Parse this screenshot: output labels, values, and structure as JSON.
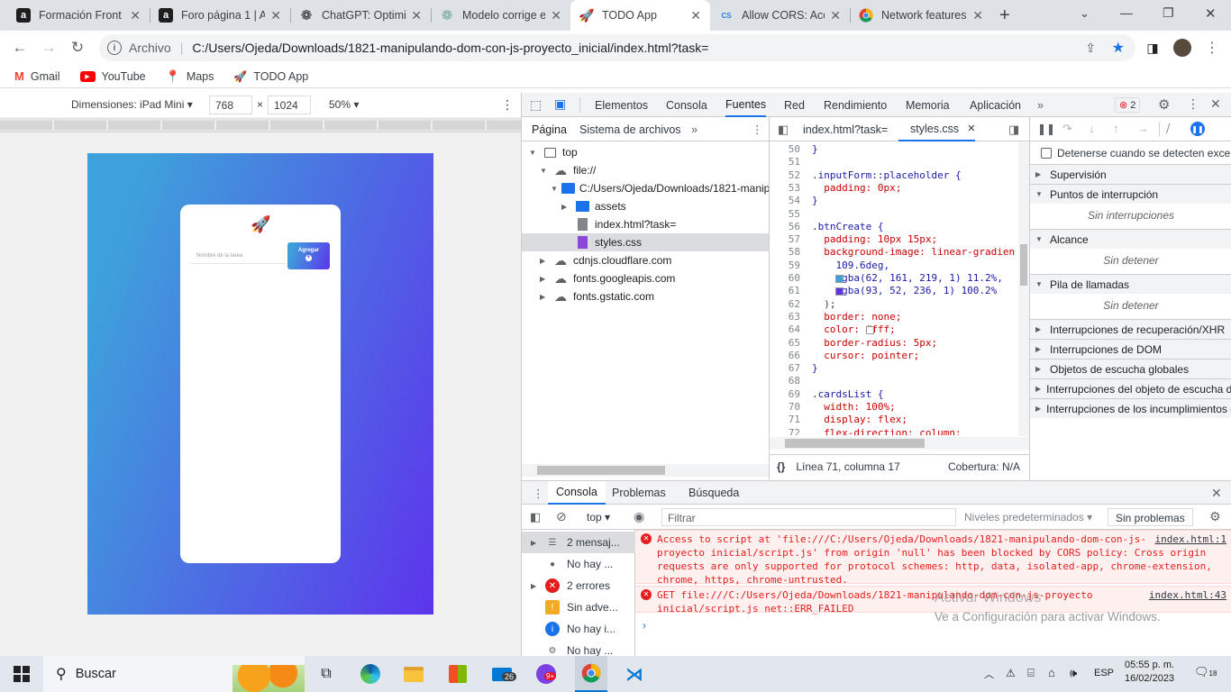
{
  "tabs": [
    {
      "title": "Formación Front",
      "favicon": "alura-icon",
      "active": false
    },
    {
      "title": "Foro página 1 | A",
      "favicon": "alura-icon",
      "active": false
    },
    {
      "title": "ChatGPT: Optimiz",
      "favicon": "openai-icon",
      "active": false
    },
    {
      "title": "Modelo corrige e",
      "favicon": "openai-icon",
      "active": false
    },
    {
      "title": "TODO App",
      "favicon": "rocket-icon",
      "active": true
    },
    {
      "title": "Allow CORS: Acc",
      "favicon": "cors-icon",
      "active": false
    },
    {
      "title": "Network features",
      "favicon": "chrome-icon",
      "active": false
    }
  ],
  "address": {
    "scheme_label": "Archivo",
    "url": "C:/Users/Ojeda/Downloads/1821-manipulando-dom-con-js-proyecto_inicial/index.html?task="
  },
  "bookmarks": [
    "Gmail",
    "YouTube",
    "Maps",
    "TODO App"
  ],
  "device_toolbar": {
    "dimensions_label": "Dimensiones: iPad Mini",
    "width": "768",
    "x": "×",
    "height": "1024",
    "zoom": "50%"
  },
  "todo_page": {
    "input_placeholder": "Nombre de la tarea",
    "add_button": "Agregar",
    "gradient_start": "#3ea1db",
    "gradient_end": "#5d34ec"
  },
  "devtools": {
    "panels": [
      "Elementos",
      "Consola",
      "Fuentes",
      "Red",
      "Rendimiento",
      "Memoria",
      "Aplicación"
    ],
    "active_panel": "Fuentes",
    "error_badge": "2",
    "navigator_tabs": [
      "Página",
      "Sistema de archivos"
    ],
    "tree": [
      {
        "label": "top",
        "depth": 0,
        "expanded": true,
        "icon": "frame-icon"
      },
      {
        "label": "file://",
        "depth": 1,
        "expanded": true,
        "icon": "cloud-icon"
      },
      {
        "label": "C:/Users/Ojeda/Downloads/1821-manip",
        "depth": 2,
        "expanded": true,
        "icon": "folder-icon"
      },
      {
        "label": "assets",
        "depth": 3,
        "expanded": false,
        "icon": "folder-icon"
      },
      {
        "label": "index.html?task=",
        "depth": 3,
        "icon": "file-icon"
      },
      {
        "label": "styles.css",
        "depth": 3,
        "icon": "css-file-icon",
        "selected": true
      },
      {
        "label": "cdnjs.cloudflare.com",
        "depth": 1,
        "expanded": false,
        "icon": "cloud-icon"
      },
      {
        "label": "fonts.googleapis.com",
        "depth": 1,
        "expanded": false,
        "icon": "cloud-icon"
      },
      {
        "label": "fonts.gstatic.com",
        "depth": 1,
        "expanded": false,
        "icon": "cloud-icon"
      }
    ],
    "editor_tabs": [
      "index.html?task=",
      "styles.css"
    ],
    "active_editor_tab": "styles.css",
    "code_lines": [
      {
        "n": "50",
        "t": "}"
      },
      {
        "n": "51",
        "t": ""
      },
      {
        "n": "52",
        "t": ".inputForm::placeholder {"
      },
      {
        "n": "53",
        "t": "  padding: 0px;"
      },
      {
        "n": "54",
        "t": "}"
      },
      {
        "n": "55",
        "t": ""
      },
      {
        "n": "56",
        "t": ".btnCreate {"
      },
      {
        "n": "57",
        "t": "  padding: 10px 15px;"
      },
      {
        "n": "58",
        "t": "  background-image: linear-gradien"
      },
      {
        "n": "59",
        "t": "    109.6deg,"
      },
      {
        "n": "60",
        "t": "    rgba(62, 161, 219, 1) 11.2%,"
      },
      {
        "n": "61",
        "t": "    rgba(93, 52, 236, 1) 100.2%"
      },
      {
        "n": "62",
        "t": "  );"
      },
      {
        "n": "63",
        "t": "  border: none;"
      },
      {
        "n": "64",
        "t": "  color: #fff;"
      },
      {
        "n": "65",
        "t": "  border-radius: 5px;"
      },
      {
        "n": "66",
        "t": "  cursor: pointer;"
      },
      {
        "n": "67",
        "t": "}"
      },
      {
        "n": "68",
        "t": ""
      },
      {
        "n": "69",
        "t": ".cardsList {"
      },
      {
        "n": "70",
        "t": "  width: 100%;"
      },
      {
        "n": "71",
        "t": "  display: flex;"
      },
      {
        "n": "72",
        "t": "  flex-direction: column;"
      }
    ],
    "status_bar": {
      "braces": "{}",
      "position": "Línea 71, columna 17",
      "coverage": "Cobertura: N/A"
    },
    "debugger": {
      "pause_on_exceptions": "Detenerse cuando se detecten exce...",
      "sections": [
        {
          "label": "Supervisión",
          "expanded": false
        },
        {
          "label": "Puntos de interrupción",
          "expanded": true,
          "empty": "Sin interrupciones"
        },
        {
          "label": "Alcance",
          "expanded": true,
          "empty": "Sin detener"
        },
        {
          "label": "Pila de llamadas",
          "expanded": true,
          "empty": "Sin detener"
        },
        {
          "label": "Interrupciones de recuperación/XHR",
          "expanded": false
        },
        {
          "label": "Interrupciones de DOM",
          "expanded": false
        },
        {
          "label": "Objetos de escucha globales",
          "expanded": false
        },
        {
          "label": "Interrupciones del objeto de escucha d",
          "expanded": false
        },
        {
          "label": "Interrupciones de los incumplimientos d",
          "expanded": false
        }
      ]
    },
    "drawer_tabs": [
      "Consola",
      "Problemas",
      "Búsqueda"
    ],
    "console_toolbar": {
      "context": "top",
      "filter_placeholder": "Filtrar",
      "levels": "Niveles predeterminados",
      "issues": "Sin problemas"
    },
    "console_sidebar": [
      {
        "label": "2 mensaj...",
        "icon": "list-icon"
      },
      {
        "label": "No hay ...",
        "icon": "user-icon"
      },
      {
        "label": "2 errores",
        "icon": "error-icon"
      },
      {
        "label": "Sin adve...",
        "icon": "warning-icon"
      },
      {
        "label": "No hay i...",
        "icon": "info-icon"
      },
      {
        "label": "No hay ...",
        "icon": "gear-icon"
      }
    ],
    "messages": [
      {
        "text": "Access to script at 'file:///C:/Users/Ojeda/Downloads/1821-manipulando-dom-con-js-proyecto inicial/script.js' from origin 'null' has been blocked by CORS policy: Cross origin requests are only supported for protocol schemes: http, data, isolated-app, chrome-extension, chrome, https, chrome-untrusted.",
        "source": "index.html:1"
      },
      {
        "text": "GET file:///C:/Users/Ojeda/Downloads/1821-manipulando-dom-con-js-proyecto inicial/script.js net::ERR_FAILED",
        "source": "index.html:43"
      }
    ],
    "watermark": {
      "line1": "Activar Windows",
      "line2": "Ve a Configuración para activar Windows."
    }
  },
  "taskbar": {
    "search": "Buscar",
    "time": "05:55 p. m.",
    "date": "16/02/2023",
    "lang": "ESP",
    "notif": "18",
    "mail_badge": "26",
    "app_badge": "9+"
  }
}
